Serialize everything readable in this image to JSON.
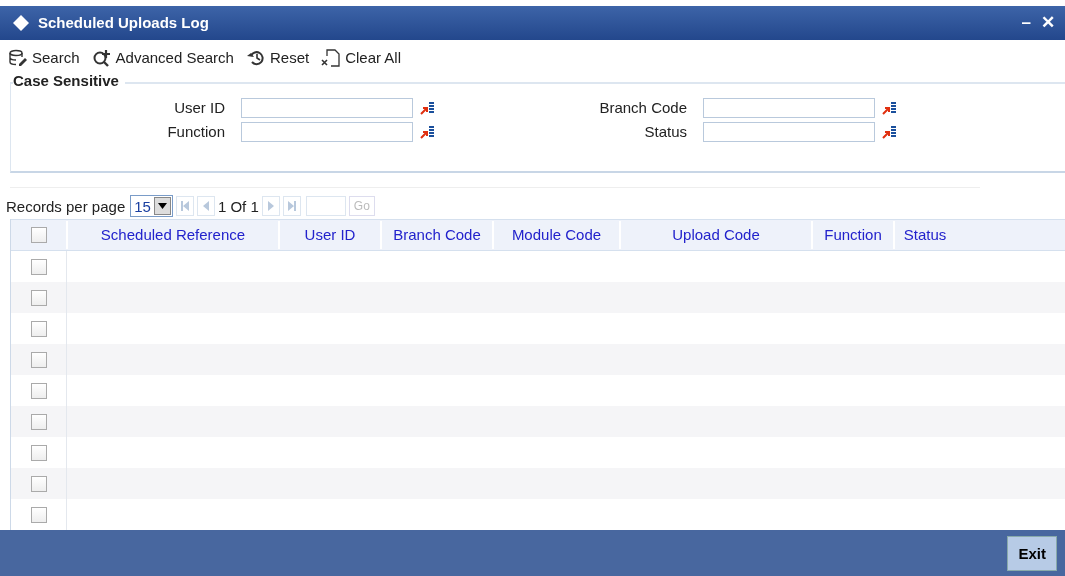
{
  "window": {
    "title": "Scheduled Uploads Log",
    "controls": [
      "–",
      "✕"
    ]
  },
  "toolbar": [
    {
      "kind": "search",
      "label": "Search"
    },
    {
      "kind": "advanced",
      "label": "Advanced Search"
    },
    {
      "kind": "reset",
      "label": "Reset"
    },
    {
      "kind": "clear",
      "label": "Clear All"
    }
  ],
  "criteria": {
    "legend": "Case Sensitive",
    "fields": [
      {
        "label": "User ID"
      },
      {
        "label": "Branch Code"
      },
      {
        "label": "Function"
      },
      {
        "label": "Status"
      }
    ]
  },
  "pagination": {
    "label": "Records per page",
    "per_page": "15",
    "page_info": "1 Of 1",
    "go": "Go"
  },
  "table": {
    "header_checked": false,
    "columns": [
      "Scheduled Reference",
      "User ID",
      "Branch Code",
      "Module Code",
      "Upload Code",
      "Function",
      "Status"
    ],
    "rows": [
      {
        "checked": false
      },
      {
        "checked": false
      },
      {
        "checked": false
      },
      {
        "checked": false
      },
      {
        "checked": false
      },
      {
        "checked": false
      },
      {
        "checked": false
      },
      {
        "checked": false
      },
      {
        "checked": false
      }
    ]
  },
  "footer": {
    "button": "Exit"
  }
}
